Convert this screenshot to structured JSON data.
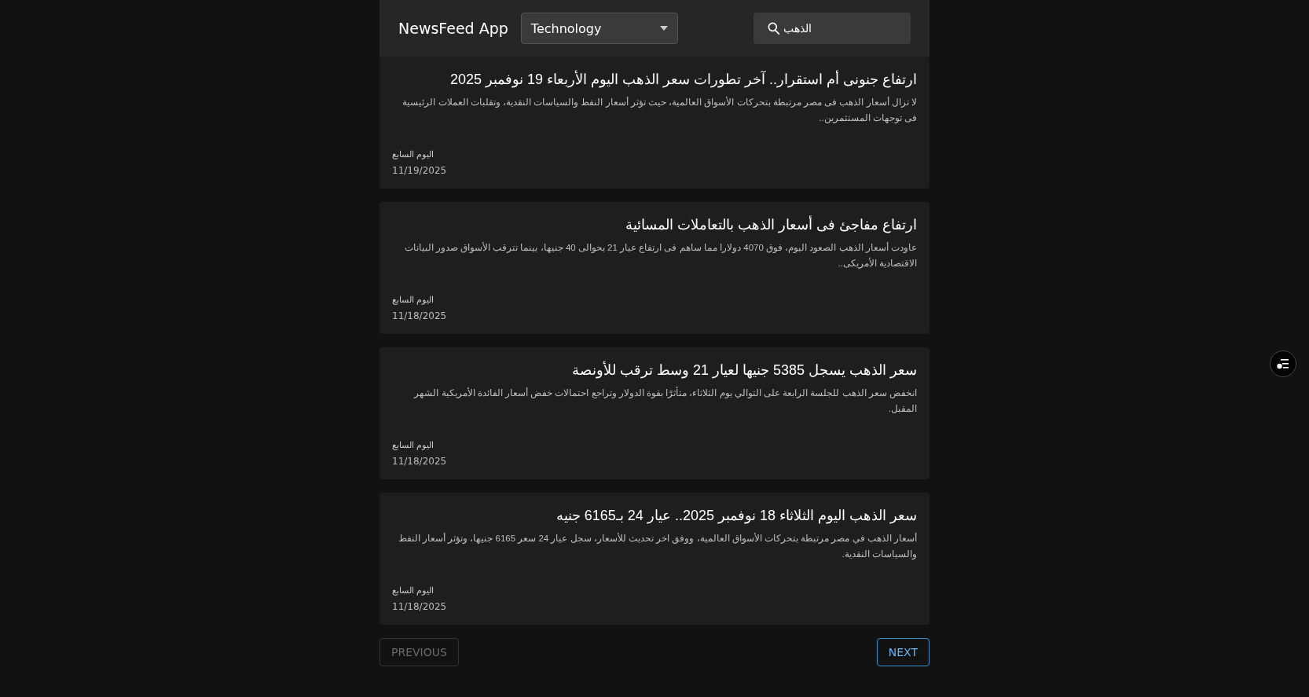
{
  "header": {
    "title": "NewsFeed App",
    "category": {
      "value": "Technology"
    },
    "search": {
      "value": "الذهب"
    }
  },
  "articles": [
    {
      "title": "ارتفاع جنونى أم استقرار.. آخر تطورات سعر الذهب اليوم الأربعاء 19 نوفمبر 2025",
      "summary": "لا تزال أسعار الذهب فى مصر مرتبطة بتحركات الأسواق العالمية، حيث تؤثر أسعار النفط والسياسات النقدية، وتقلبات العملات الرئيسية فى توجهات المستثمرين..",
      "source": "اليوم السابع",
      "date": "11/19/2025"
    },
    {
      "title": "ارتفاع مفاجئ فى أسعار الذهب بالتعاملات المسائية",
      "summary": "عاودت أسعار الذهب الصعود اليوم، فوق 4070 دولارا مما ساهم فى ارتفاع عيار 21 بحوالى 40 جنيها، بينما تترقب الأسواق صدور البيانات الاقتصادية الأمريكى..",
      "source": "اليوم السابع",
      "date": "11/18/2025"
    },
    {
      "title": "سعر الذهب يسجل 5385 جنيها لعيار 21 وسط ترقب للأونصة",
      "summary": "انخفض سعر الذهب للجلسة الرابعة على التوالي يوم الثلاثاء، متأثرًا بقوة الدولار وتراجع احتمالات خفض أسعار الفائدة الأمريكية الشهر المقبل.",
      "source": "اليوم السابع",
      "date": "11/18/2025"
    },
    {
      "title": "سعر الذهب اليوم الثلاثاء 18 نوفمبر 2025.. عيار 24 بـ6165 جنيه",
      "summary": "أسعار الذهب في مصر مرتبطة بتحركات الأسواق العالمية، ووفق اخر تحديث للأسعار، سجل عيار 24 سعر 6165 جنيها، وتؤثر أسعار النفط والسياسات النقدية.",
      "source": "اليوم السابع",
      "date": "11/18/2025"
    }
  ],
  "previous_button": {
    "label": "PREVIOUS",
    "disabled": true
  },
  "next_button": {
    "label": "NEXT",
    "disabled": false
  }
}
